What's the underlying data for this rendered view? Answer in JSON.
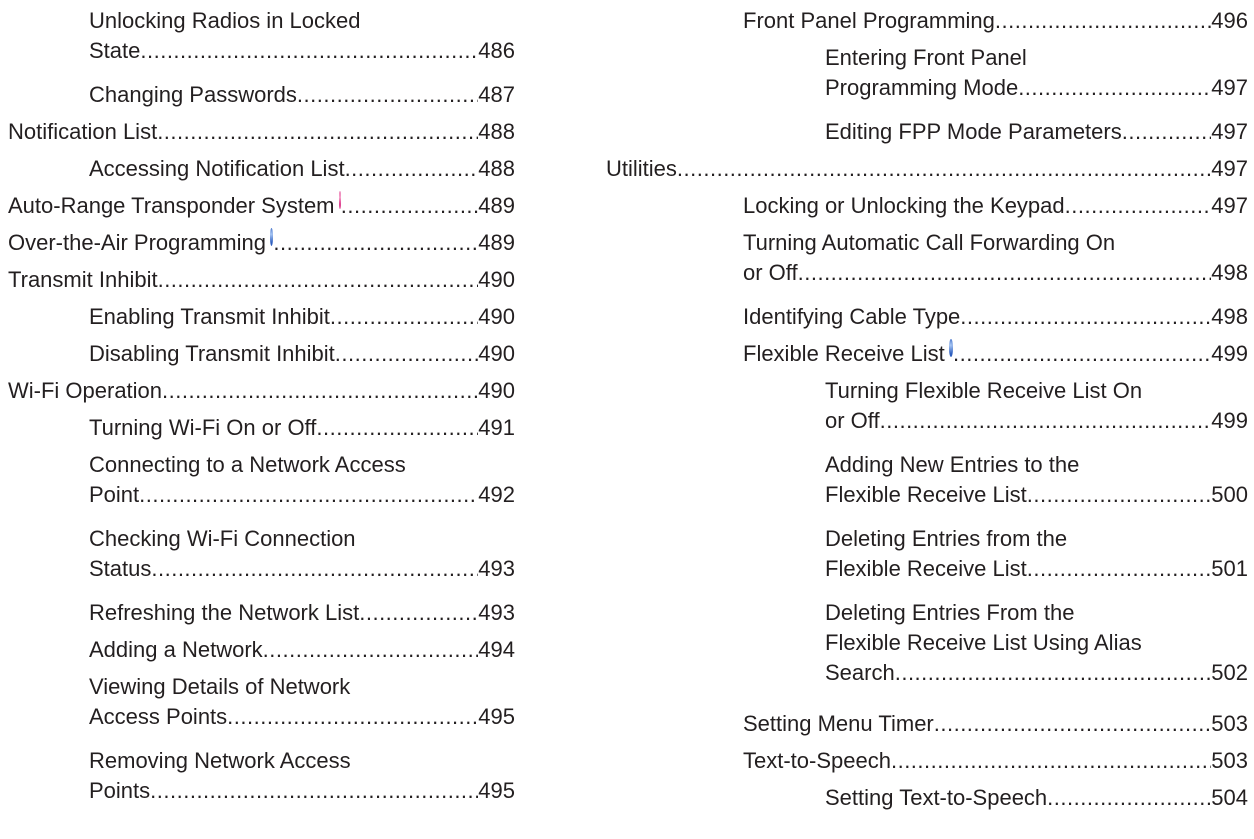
{
  "left_entries": [
    {
      "lines": [
        "Unlocking Radios in Locked",
        "State"
      ],
      "page": "486"
    },
    {
      "lines": [
        "Changing Passwords"
      ],
      "page": "487"
    },
    {
      "lines": [
        "Notification List "
      ],
      "page": "488"
    },
    {
      "lines": [
        "Accessing Notification List "
      ],
      "page": "488"
    },
    {
      "lines": [
        "Auto-Range Transponder System "
      ],
      "page": "489",
      "icon": "pink-lock-icon"
    },
    {
      "lines": [
        "Over-the-Air Programming "
      ],
      "page": "489",
      "icon": "blue-lock-icon"
    },
    {
      "lines": [
        "Transmit Inhibit"
      ],
      "page": "490"
    },
    {
      "lines": [
        "Enabling Transmit Inhibit"
      ],
      "page": "490"
    },
    {
      "lines": [
        "Disabling Transmit Inhibit"
      ],
      "page": "490"
    },
    {
      "lines": [
        "Wi-Fi Operation"
      ],
      "page": "490"
    },
    {
      "lines": [
        "Turning Wi-Fi On or Off"
      ],
      "page": "491"
    },
    {
      "lines": [
        "Connecting to a Network Access",
        "Point"
      ],
      "page": "492"
    },
    {
      "lines": [
        "Checking Wi-Fi Connection",
        "Status "
      ],
      "page": "493"
    },
    {
      "lines": [
        "Refreshing the Network List"
      ],
      "page": "493"
    },
    {
      "lines": [
        "Adding a Network"
      ],
      "page": "494"
    },
    {
      "lines": [
        "Viewing Details of Network",
        "Access Points"
      ],
      "page": "495"
    },
    {
      "lines": [
        "Removing Network Access",
        "Points"
      ],
      "page": "495"
    }
  ],
  "right_entries": [
    {
      "lines": [
        "Front Panel Programming"
      ],
      "page": "496"
    },
    {
      "lines": [
        "Entering Front Panel",
        "Programming Mode"
      ],
      "page": "497"
    },
    {
      "lines": [
        "Editing FPP Mode Parameters"
      ],
      "page": "497"
    },
    {
      "lines": [
        "Utilities"
      ],
      "page": "497"
    },
    {
      "lines": [
        "Locking or Unlocking the Keypad"
      ],
      "page": "497"
    },
    {
      "lines": [
        "Turning Automatic Call Forwarding On",
        "or Off"
      ],
      "page": "498"
    },
    {
      "lines": [
        "Identifying Cable Type"
      ],
      "page": "498"
    },
    {
      "lines": [
        "Flexible Receive List "
      ],
      "page": "499",
      "icon": "blue-lock-icon"
    },
    {
      "lines": [
        "Turning Flexible Receive List On",
        "or Off"
      ],
      "page": "499"
    },
    {
      "lines": [
        "Adding New Entries to the",
        "Flexible Receive List"
      ],
      "page": "500"
    },
    {
      "lines": [
        "Deleting Entries from the",
        "Flexible Receive List"
      ],
      "page": "501"
    },
    {
      "lines": [
        "Deleting Entries From the",
        "Flexible Receive List Using Alias",
        "Search"
      ],
      "page": "502"
    },
    {
      "lines": [
        "Setting Menu Timer"
      ],
      "page": "503"
    },
    {
      "lines": [
        "Text-to-Speech"
      ],
      "page": "503"
    },
    {
      "lines": [
        "Setting Text-to-Speech"
      ],
      "page": "504"
    }
  ]
}
